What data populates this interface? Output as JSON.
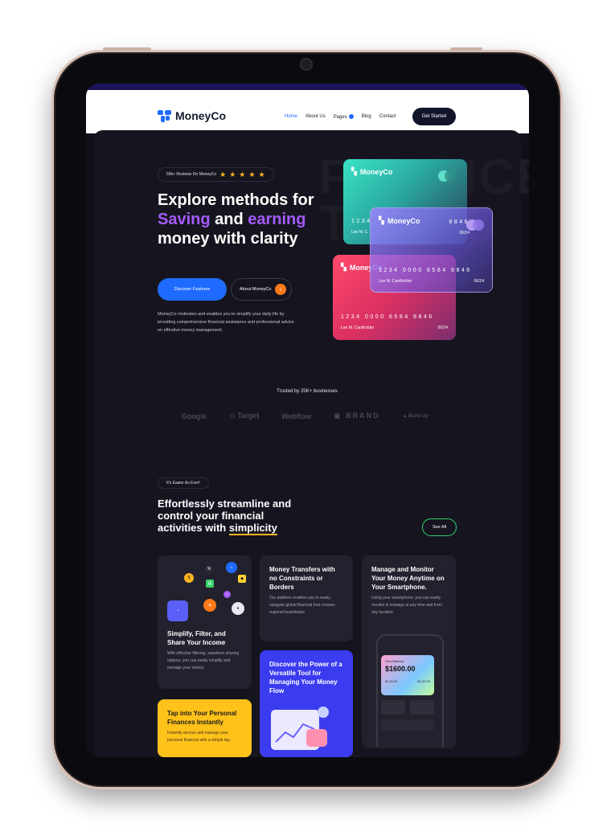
{
  "nav": {
    "brand": "MoneyCo",
    "items": [
      "Home",
      "About Us",
      "Pages",
      "Blog",
      "Contact"
    ],
    "cta": "Get Started"
  },
  "hero": {
    "reviews": "50k+ Reviews On MoneyCo",
    "headline_1": "Explore methods for ",
    "headline_hl1": "Saving",
    "headline_2": " and ",
    "headline_hl2": "earning",
    "headline_3": " money with clarity",
    "primary_cta": "Discover Features",
    "secondary_cta": "About MoneyCo",
    "description": "MoneyCo motivates and enables you to simplify your daily life by providing comprehensive financial assistance and professional advice on effective money management.",
    "watermark": "FINANCE TOOLS"
  },
  "cards": {
    "teal": {
      "brand": "MoneyCo",
      "number": "1234",
      "holder": "Lee M. C"
    },
    "purple": {
      "brand": "MoneyCo",
      "number": "9846",
      "expiry": "06/24",
      "number2": "1234 0000 6584 9846",
      "holder2": "Lee M. Cardholder",
      "expiry2": "06/24"
    },
    "red": {
      "brand": "MoneyCo",
      "number": "1234 0000 6584 9846",
      "holder": "Lee M. Cardholder",
      "expiry": "06/24"
    }
  },
  "trusted": {
    "label": "Trusted by 25K+ businesses",
    "logos": [
      "Google",
      "Target",
      "Webflow",
      "BRAND",
      "Build Up"
    ]
  },
  "features": {
    "badge": "It's Easier As Ever!",
    "title_1": "Effortlessly streamline and control your financial activities with ",
    "title_ul": "simplicity",
    "see_all": "See All",
    "cards": [
      {
        "title": "Simplify, Filter, and Share Your Income",
        "text": "With effective filtering, seamless sharing options, you can easily simplify and manage your money."
      },
      {
        "title": "Money Transfers with no Constraints or Borders",
        "text": "Our platform enables you to easily navigate global financial that crosses regional boundaries."
      },
      {
        "title": "Manage and Monitor Your Money Anytime on Your Smartphone.",
        "text": "Using your smartphone, you can easily monitor & manage at any time and from any location."
      },
      {
        "title": "Discover the Power of a Versatile Tool for Managing Your Money Flow",
        "text": ""
      },
      {
        "title": "Tap into Your Personal Finances Instantly",
        "text": "Instantly access and manage your personal finances with a simple tap."
      }
    ],
    "balance_label": "Your Balance",
    "balance_value": "$1600.00",
    "balance_in": "$1,00.00",
    "balance_out": "$1,00.00"
  },
  "colors": {
    "accent_blue": "#1f6bff",
    "accent_purple": "#a45bff",
    "accent_orange": "#ff7a1a",
    "accent_yellow": "#ffc21a"
  }
}
